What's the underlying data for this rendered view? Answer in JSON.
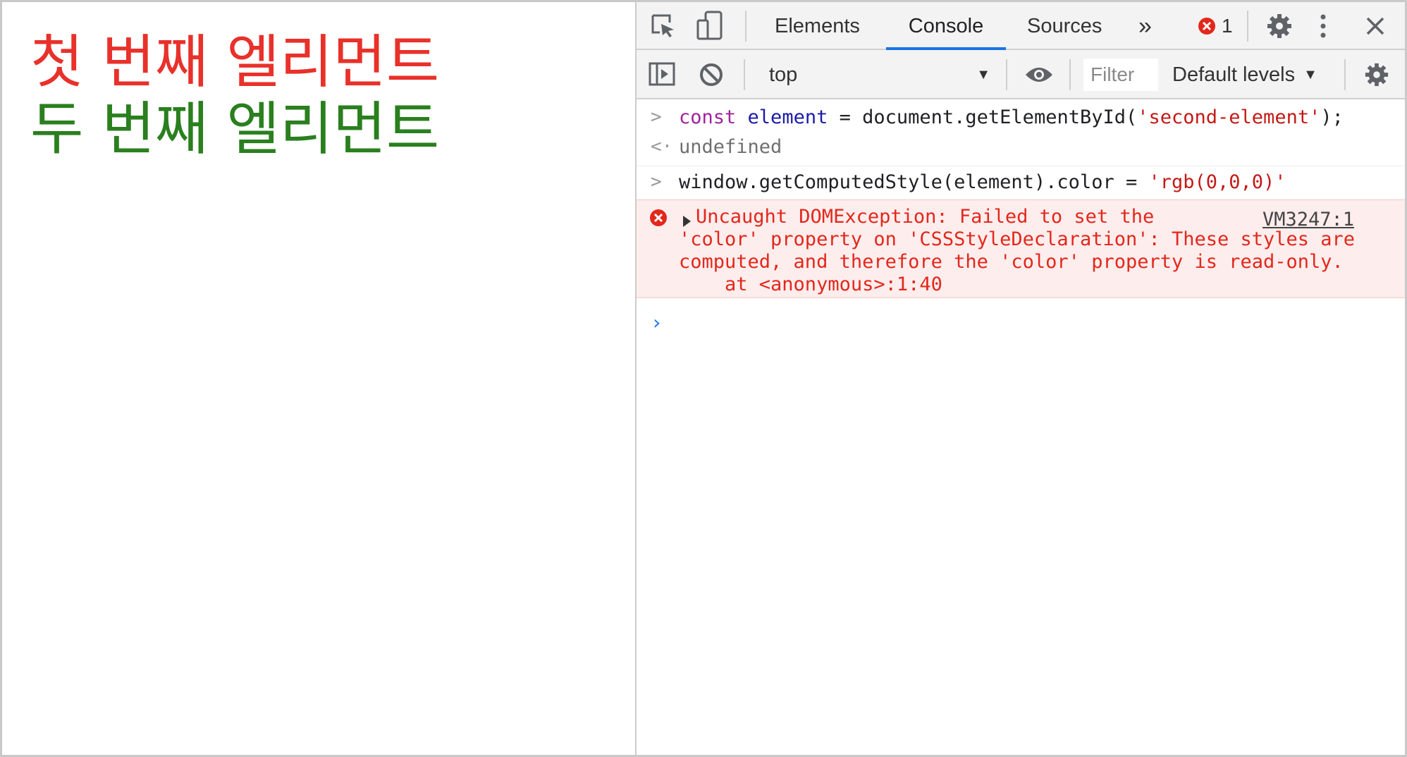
{
  "page": {
    "line1": "첫 번째 엘리먼트",
    "line2": "두 번째 엘리먼트",
    "line1_color": "#e8312a",
    "line2_color": "#2a7f1e"
  },
  "devtools": {
    "tabs": [
      {
        "label": "Elements",
        "active": false
      },
      {
        "label": "Console",
        "active": true
      },
      {
        "label": "Sources",
        "active": false
      }
    ],
    "more_tabs_label": "»",
    "error_count": "1",
    "context": "top",
    "filter_placeholder": "Filter",
    "levels": "Default levels",
    "accent_color": "#1a73e8"
  },
  "console": {
    "line1_kw": "const",
    "line1_var": "element",
    "line1_rest1": " = document.getElementById(",
    "line1_str": "'second-element'",
    "line1_rest2": ");",
    "result1": "undefined",
    "line2_code": "window.getComputedStyle(element).color = ",
    "line2_str": "'rgb(0,0,0)'",
    "error_line1": "Uncaught DOMException: Failed to set the",
    "error_line2": "'color' property on 'CSSStyleDeclaration': These styles are",
    "error_line3": "computed, and therefore the 'color' property is read-only.",
    "error_line4": "    at <anonymous>:1:40",
    "error_source": "VM3247:1",
    "prompt_symbol": "›"
  }
}
